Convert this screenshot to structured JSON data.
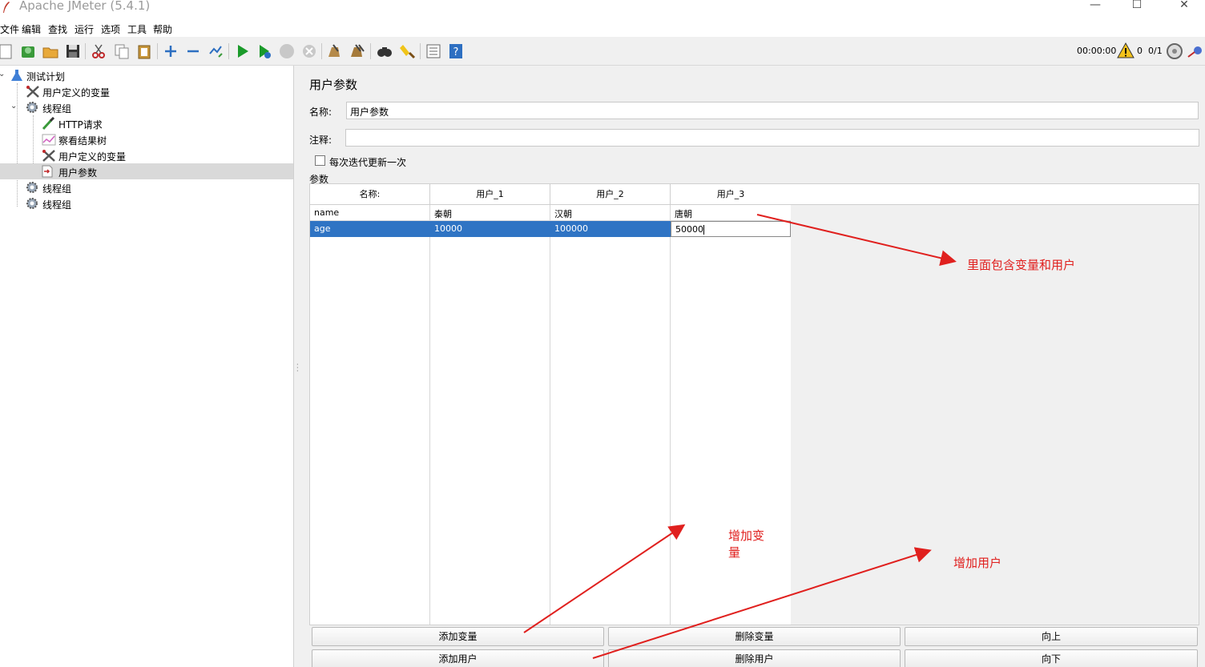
{
  "window": {
    "title": "Apache JMeter (5.4.1)",
    "minimize_glyph": "—",
    "maximize_glyph": "☐",
    "close_glyph": "✕"
  },
  "menubar": {
    "items": [
      "文件",
      "编辑",
      "查找",
      "运行",
      "选项",
      "工具",
      "帮助"
    ]
  },
  "toolbar": {
    "icons": [
      "new-icon",
      "templates-icon",
      "open-icon",
      "save-icon",
      "cut-icon",
      "copy-icon",
      "paste-icon",
      "expand-icon",
      "collapse-icon",
      "toggle-icon",
      "start-icon",
      "start-no-pause-icon",
      "stop-icon",
      "shutdown-icon",
      "clear-icon",
      "clear-all-icon",
      "search-icon",
      "reset-search-icon",
      "function-helper-icon",
      "help-icon"
    ],
    "timer": "00:00:00",
    "warning_count": "0",
    "threads": "0/1"
  },
  "tree": {
    "items": [
      {
        "label": "测试计划",
        "icon": "flask-icon"
      },
      {
        "label": "用户定义的变量",
        "icon": "tools-icon"
      },
      {
        "label": "线程组",
        "icon": "gear-icon"
      },
      {
        "label": "HTTP请求",
        "icon": "pipette-icon"
      },
      {
        "label": "察看结果树",
        "icon": "graph-icon"
      },
      {
        "label": "用户定义的变量",
        "icon": "tools-icon"
      },
      {
        "label": "用户参数",
        "icon": "user-params-icon"
      },
      {
        "label": "线程组",
        "icon": "gear-icon"
      },
      {
        "label": "线程组",
        "icon": "gear-icon"
      }
    ],
    "selected_index": 6
  },
  "panel": {
    "title": "用户参数",
    "name_label": "名称:",
    "name_value": "用户参数",
    "comment_label": "注释:",
    "comment_value": "",
    "per_iteration_label": "每次迭代更新一次",
    "per_iteration_checked": false,
    "params_label": "参数"
  },
  "table": {
    "headers": [
      "名称:",
      "用户_1",
      "用户_2",
      "用户_3"
    ],
    "rows": [
      [
        "name",
        "秦朝",
        "汉朝",
        "唐朝"
      ],
      [
        "age",
        "10000",
        "100000",
        "50000"
      ]
    ],
    "selected_row": 1,
    "editing_cell": "row 2, 用户_3"
  },
  "buttons": {
    "add_variable": "添加变量",
    "delete_variable": "删除变量",
    "up": "向上",
    "add_user": "添加用户",
    "delete_user": "删除用户",
    "down": "向下"
  },
  "annotations": {
    "contains": "里面包含变量和用户",
    "add_variable_line1": "增加变",
    "add_variable_line2": "量",
    "add_user": "增加用户",
    "color": "#e0201e"
  }
}
